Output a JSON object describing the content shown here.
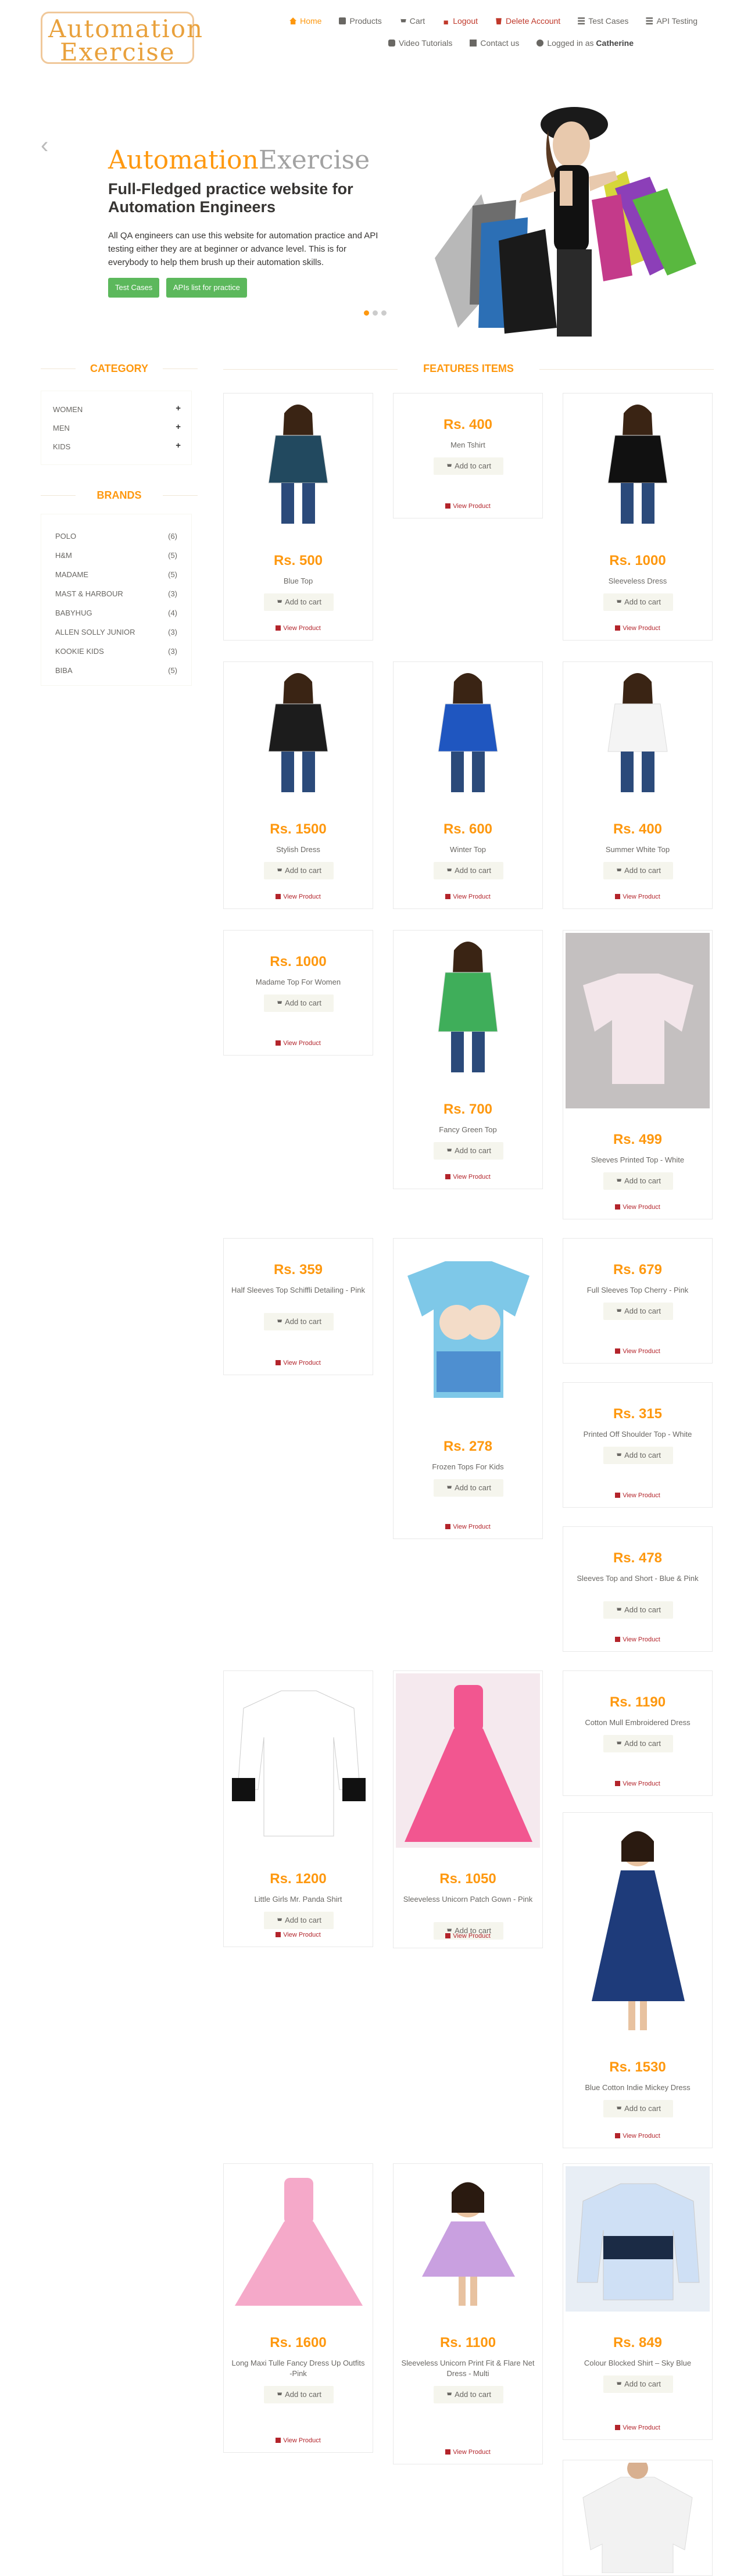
{
  "header": {
    "logo_part1": "utomation",
    "logo_part2": "xercise",
    "logo_letter1": "A",
    "logo_letter2": "E",
    "nav": {
      "home": "Home",
      "products": "Products",
      "cart": "Cart",
      "logout": "Logout",
      "delete_account": "Delete Account",
      "test_cases": "Test Cases",
      "api_testing": "API Testing",
      "video_tutorials": "Video Tutorials",
      "contact_us": "Contact us",
      "logged_in_prefix": "Logged in as",
      "username": "Catherine"
    }
  },
  "hero": {
    "title_a": "Automation",
    "title_b": "Exercise",
    "subtitle": "Full-Fledged practice website for Automation Engineers",
    "description": "All QA engineers can use this website for automation practice and API testing either they are at beginner or advance level. This is for everybody to help them brush up their automation skills.",
    "btn_test_cases": "Test Cases",
    "btn_apis": "APIs list for practice",
    "prev": "‹",
    "next": "›"
  },
  "sidebar": {
    "category_title": "CATEGORY",
    "categories": [
      "WOMEN",
      "MEN",
      "KIDS"
    ],
    "brands_title": "BRANDS",
    "brands": [
      {
        "name": "POLO",
        "count": "(6)"
      },
      {
        "name": "H&M",
        "count": "(5)"
      },
      {
        "name": "MADAME",
        "count": "(5)"
      },
      {
        "name": "MAST & HARBOUR",
        "count": "(3)"
      },
      {
        "name": "BABYHUG",
        "count": "(4)"
      },
      {
        "name": "ALLEN SOLLY JUNIOR",
        "count": "(3)"
      },
      {
        "name": "KOOKIE KIDS",
        "count": "(3)"
      },
      {
        "name": "BIBA",
        "count": "(5)"
      }
    ]
  },
  "products_title": "FEATURES ITEMS",
  "add_to_cart": "Add to cart",
  "view_product": "View Product",
  "products": [
    {
      "price": "Rs. 500",
      "name": "Blue Top"
    },
    {
      "price": "Rs. 400",
      "name": "Men Tshirt"
    },
    {
      "price": "Rs. 1000",
      "name": "Sleeveless Dress"
    },
    {
      "price": "Rs. 1500",
      "name": "Stylish Dress"
    },
    {
      "price": "Rs. 600",
      "name": "Winter Top"
    },
    {
      "price": "Rs. 400",
      "name": "Summer White Top"
    },
    {
      "price": "Rs. 1000",
      "name": "Madame Top For Women"
    },
    {
      "price": "Rs. 700",
      "name": "Fancy Green Top"
    },
    {
      "price": "Rs. 499",
      "name": "Sleeves Printed Top - White"
    },
    {
      "price": "Rs. 359",
      "name": "Half Sleeves Top Schiffli Detailing - Pink"
    },
    {
      "price": "Rs. 278",
      "name": "Frozen Tops For Kids"
    },
    {
      "price": "Rs. 679",
      "name": "Full Sleeves Top Cherry - Pink"
    },
    {
      "price": "Rs. 315",
      "name": "Printed Off Shoulder Top - White"
    },
    {
      "price": "Rs. 478",
      "name": "Sleeves Top and Short - Blue & Pink"
    },
    {
      "price": "Rs. 1200",
      "name": "Little Girls Mr. Panda Shirt"
    },
    {
      "price": "Rs. 1050",
      "name": "Sleeveless Unicorn Patch Gown - Pink"
    },
    {
      "price": "Rs. 1190",
      "name": "Cotton Mull Embroidered Dress"
    },
    {
      "price": "Rs. 1530",
      "name": "Blue Cotton Indie Mickey Dress"
    },
    {
      "price": "Rs. 1600",
      "name": "Long Maxi Tulle Fancy Dress Up Outfits -Pink"
    },
    {
      "price": "Rs. 1100",
      "name": "Sleeveless Unicorn Print Fit & Flare Net Dress - Multi"
    },
    {
      "price": "Rs. 849",
      "name": "Colour Blocked Shirt – Sky Blue"
    }
  ],
  "colors": {
    "accent": "#FE980F",
    "green": "#5cb85c",
    "red": "#b3242b"
  }
}
